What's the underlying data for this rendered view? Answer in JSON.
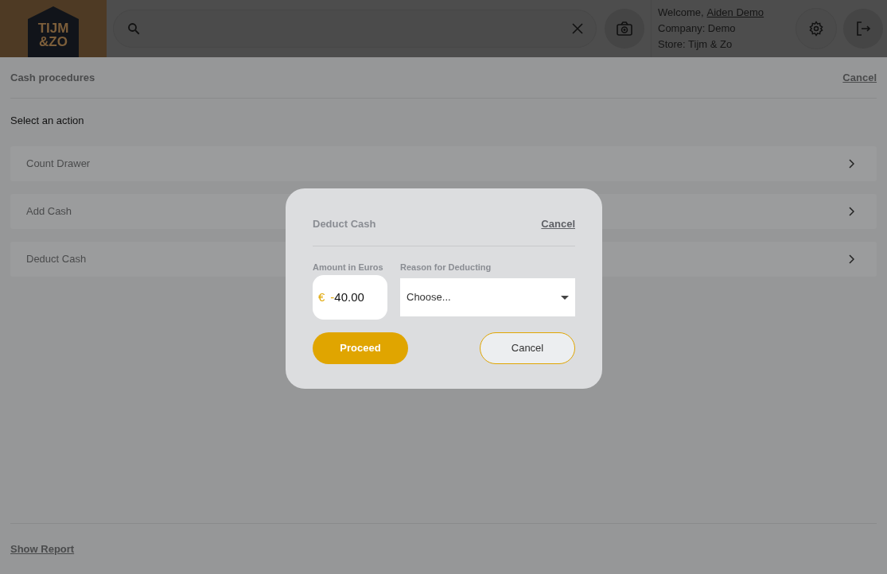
{
  "header": {
    "logo_lines": [
      "TIJM",
      "&ZO"
    ],
    "user": {
      "welcome": "Welcome,",
      "name": "Aiden Demo",
      "company": "Company: Demo",
      "store": "Store: Tijm & Zo"
    }
  },
  "page": {
    "title": "Cash procedures",
    "cancel": "Cancel",
    "subtitle": "Select an action",
    "actions": [
      "Count Drawer",
      "Add Cash",
      "Deduct Cash"
    ],
    "show_report": "Show Report"
  },
  "modal": {
    "title": "Deduct Cash",
    "cancel_link": "Cancel",
    "amount": {
      "label": "Amount in Euros",
      "currency": "€",
      "sign": "-",
      "value": "40.00"
    },
    "reason": {
      "label": "Reason for Deducting",
      "placeholder": "Choose..."
    },
    "buttons": [
      {
        "kind": "primary",
        "label": "Proceed"
      },
      {
        "kind": "secondary",
        "label": "Cancel"
      }
    ]
  }
}
